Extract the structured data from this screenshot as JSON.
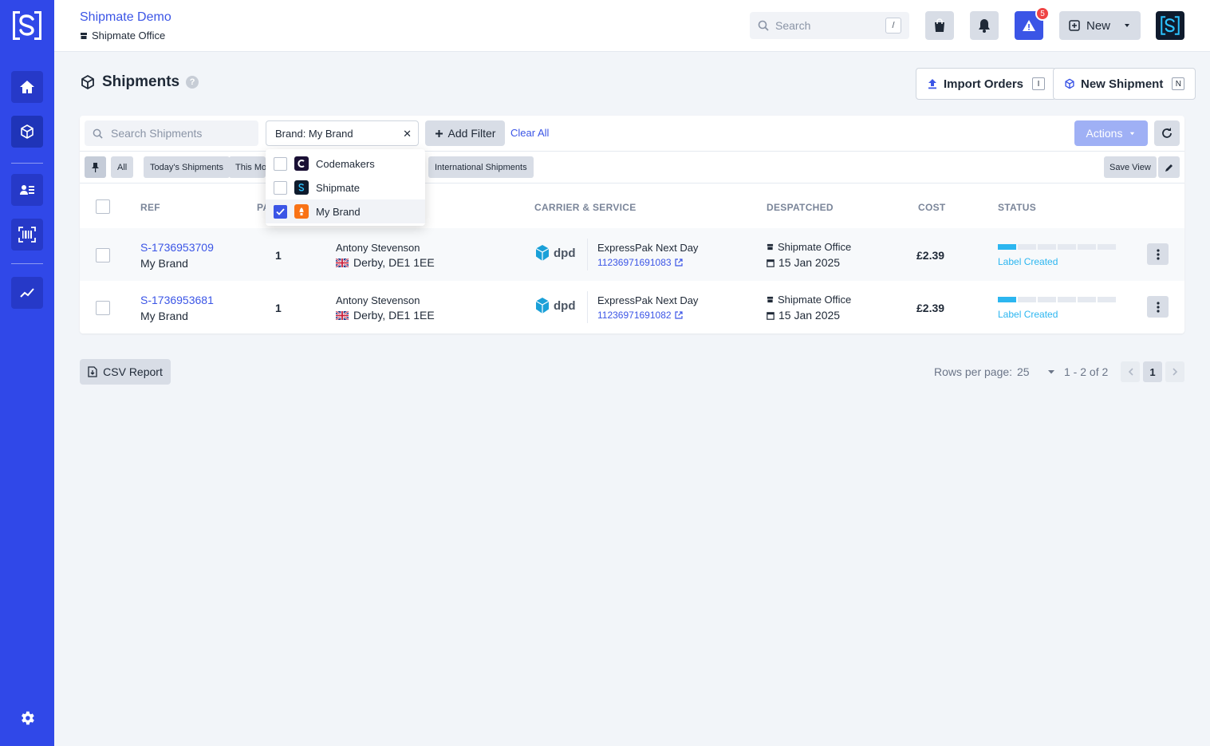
{
  "app": {
    "title": "Shipmate Demo",
    "location": "Shipmate Office"
  },
  "search": {
    "placeholder": "Search",
    "shortcut": "/"
  },
  "topbar": {
    "alert_count": "5",
    "new_label": "New"
  },
  "page": {
    "title": "Shipments",
    "import_label": "Import Orders",
    "import_key": "I",
    "new_shipment_label": "New Shipment",
    "new_shipment_key": "N"
  },
  "filters": {
    "search_placeholder": "Search Shipments",
    "brand_filter": "Brand: My Brand",
    "add_filter": "Add Filter",
    "clear_all": "Clear All",
    "actions": "Actions"
  },
  "views": [
    "All",
    "Today's Shipments",
    "This Month",
    "International Shipments"
  ],
  "save_view": "Save View",
  "brand_options": [
    {
      "label": "Codemakers",
      "checked": false
    },
    {
      "label": "Shipmate",
      "checked": false
    },
    {
      "label": "My Brand",
      "checked": true
    }
  ],
  "columns": {
    "ref": "REF",
    "parcels": "PA",
    "carrier": "CARRIER & SERVICE",
    "despatched": "DESPATCHED",
    "cost": "COST",
    "status": "STATUS"
  },
  "rows": [
    {
      "ref": "S-1736953709",
      "brand": "My Brand",
      "parcels": "1",
      "name": "Antony Stevenson",
      "address": "Derby, DE1 1EE",
      "carrier": "dpd",
      "service": "ExpressPak Next Day",
      "tracking": "11236971691083",
      "depot": "Shipmate Office",
      "date": "15 Jan 2025",
      "cost": "£2.39",
      "status": "Label Created",
      "progress": 0.17
    },
    {
      "ref": "S-1736953681",
      "brand": "My Brand",
      "parcels": "1",
      "name": "Antony Stevenson",
      "address": "Derby, DE1 1EE",
      "carrier": "dpd",
      "service": "ExpressPak Next Day",
      "tracking": "11236971691082",
      "depot": "Shipmate Office",
      "date": "15 Jan 2025",
      "cost": "£2.39",
      "status": "Label Created",
      "progress": 0.17
    }
  ],
  "footer": {
    "csv": "CSV Report",
    "rows_label": "Rows per page:",
    "rows_value": "25",
    "range": "1 - 2 of 2",
    "page": "1"
  },
  "colors": {
    "primary": "#3048e8",
    "accent": "#3b55e6",
    "status": "#2cb6f0"
  }
}
